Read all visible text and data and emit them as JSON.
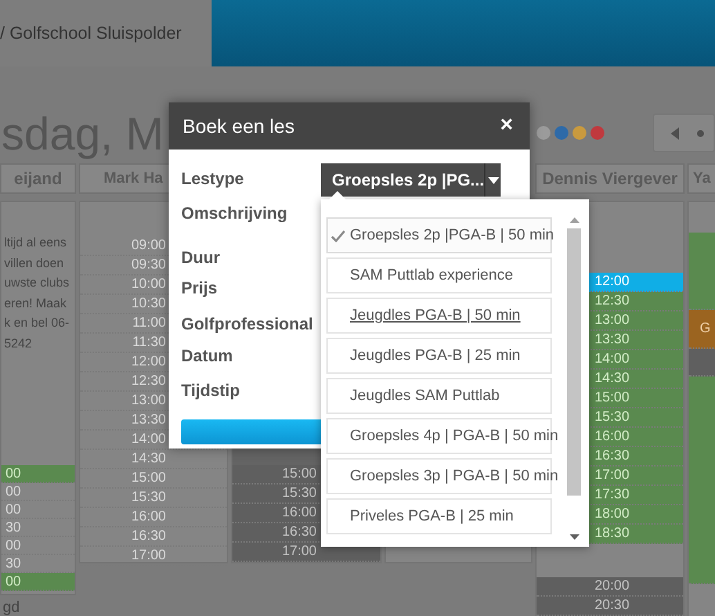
{
  "header": {
    "brand": "/ Golfschool Sluispolder"
  },
  "page_title": "sdag, M",
  "color_filters": [
    {
      "color": "#9b9b9b"
    },
    {
      "color": "#2e6aa8"
    },
    {
      "color": "#c99a3e"
    },
    {
      "color": "#c0393e"
    }
  ],
  "calendar": {
    "columns": [
      {
        "header": "eijand",
        "unavailable": false,
        "notes": [
          "ltijd al eens",
          "villen doen",
          "uwste clubs",
          "eren! Maak",
          "k en bel 06-",
          "5242"
        ],
        "slots": [
          {
            "time": "00",
            "kind": "booked"
          },
          {
            "time": "00",
            "kind": "free"
          },
          {
            "time": "00",
            "kind": "free"
          },
          {
            "time": "30",
            "kind": "free"
          },
          {
            "time": "00",
            "kind": "free"
          },
          {
            "time": "30",
            "kind": "free"
          },
          {
            "time": "00",
            "kind": "booked"
          }
        ],
        "footer": "gd"
      },
      {
        "header": "Mark Ha",
        "unavailable": false,
        "slots": [
          {
            "time": "09:00",
            "kind": "free"
          },
          {
            "time": "09:30",
            "kind": "free"
          },
          {
            "time": "10:00",
            "kind": "free"
          },
          {
            "time": "10:30",
            "kind": "free"
          },
          {
            "time": "11:00",
            "kind": "free"
          },
          {
            "time": "11:30",
            "kind": "free"
          },
          {
            "time": "12:00",
            "kind": "free"
          },
          {
            "time": "12:30",
            "kind": "free"
          },
          {
            "time": "13:00",
            "kind": "free"
          },
          {
            "time": "13:30",
            "kind": "free"
          },
          {
            "time": "14:00",
            "kind": "free"
          },
          {
            "time": "14:30",
            "kind": "free"
          },
          {
            "time": "15:00",
            "kind": "free"
          },
          {
            "time": "15:30",
            "kind": "free"
          },
          {
            "time": "16:00",
            "kind": "free"
          },
          {
            "time": "16:30",
            "kind": "free"
          },
          {
            "time": "17:00",
            "kind": "free"
          }
        ]
      },
      {
        "unavailable": true,
        "slots": [
          {
            "time": "15:00",
            "kind": "blocked"
          },
          {
            "time": "15:30",
            "kind": "blocked"
          },
          {
            "time": "16:00",
            "kind": "blocked"
          },
          {
            "time": "16:30",
            "kind": "blocked"
          },
          {
            "time": "17:00",
            "kind": "blocked"
          }
        ]
      },
      {
        "unavailable": false
      },
      {
        "header": "Dennis Viergever",
        "unavailable": false,
        "slots": [
          {
            "time": "12:00",
            "kind": "selected"
          },
          {
            "time": "12:30",
            "kind": "booked"
          },
          {
            "time": "13:00",
            "kind": "booked"
          },
          {
            "time": "13:30",
            "kind": "booked"
          },
          {
            "time": "14:00",
            "kind": "booked"
          },
          {
            "time": "14:30",
            "kind": "booked"
          },
          {
            "time": "15:00",
            "kind": "booked"
          },
          {
            "time": "15:30",
            "kind": "booked"
          },
          {
            "time": "16:00",
            "kind": "booked"
          },
          {
            "time": "16:30",
            "kind": "booked"
          },
          {
            "time": "17:00",
            "kind": "booked"
          },
          {
            "time": "17:30",
            "kind": "booked"
          },
          {
            "time": "18:00",
            "kind": "booked"
          },
          {
            "time": "18:30",
            "kind": "booked"
          },
          {
            "time": "20:00",
            "kind": "blocked"
          },
          {
            "time": "20:30",
            "kind": "blocked"
          }
        ]
      },
      {
        "header": "Ya",
        "unavailable": false,
        "slots": [
          {
            "kind": "booked"
          },
          {
            "kind": "lesson",
            "label": "G"
          },
          {
            "kind": "blocked"
          },
          {
            "kind": "booked"
          }
        ]
      }
    ]
  },
  "dialog": {
    "title": "Boek een les",
    "close": "×",
    "fields": [
      {
        "label": "Lestype"
      },
      {
        "label": "Omschrijving"
      },
      {
        "label": "Duur"
      },
      {
        "label": "Prijs"
      },
      {
        "label": "Golfprofessional"
      },
      {
        "label": "Datum"
      },
      {
        "label": "Tijdstip"
      }
    ],
    "lestype_value": "Groepsles 2p |PG...",
    "options": [
      {
        "label": "Groepsles 2p |PGA-B | 50 min",
        "selected": true,
        "hovered": false
      },
      {
        "label": "SAM Puttlab experience",
        "selected": false,
        "hovered": false
      },
      {
        "label": "Jeugdles PGA-B | 50 min",
        "selected": false,
        "hovered": true
      },
      {
        "label": "Jeugdles PGA-B | 25 min",
        "selected": false,
        "hovered": false
      },
      {
        "label": "Jeugdles SAM Puttlab",
        "selected": false,
        "hovered": false
      },
      {
        "label": "Groepsles 4p | PGA-B | 50 min",
        "selected": false,
        "hovered": false
      },
      {
        "label": "Groepsles 3p | PGA-B | 50 min",
        "selected": false,
        "hovered": false
      },
      {
        "label": "Priveles PGA-B | 25 min",
        "selected": false,
        "hovered": false
      }
    ]
  }
}
